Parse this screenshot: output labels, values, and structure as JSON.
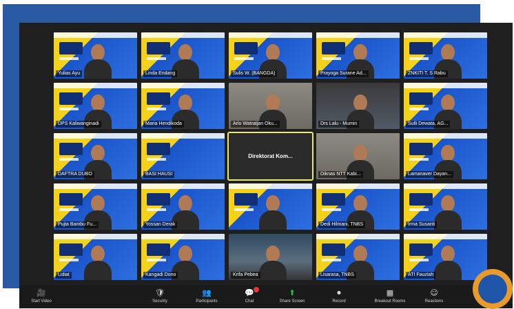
{
  "participants": [
    {
      "name": "Yulias Ayu",
      "style": "banner"
    },
    {
      "name": "Linda Endang",
      "style": "banner"
    },
    {
      "name": "Sulis W. (BANGDA)",
      "style": "banner"
    },
    {
      "name": "Prayoga Surane Ad...",
      "style": "banner"
    },
    {
      "name": "ZNKITI T. S Rabu",
      "style": "banner"
    },
    {
      "name": "DPS Kaliwanginadi",
      "style": "banner"
    },
    {
      "name": "Maria Hendikoda",
      "style": "banner"
    },
    {
      "name": "Arlo Watratjan Oku...",
      "style": "room"
    },
    {
      "name": "Drs Lalu - Mumin",
      "style": "room2"
    },
    {
      "name": "Sulli Dewata, AG...",
      "style": "banner"
    },
    {
      "name": "DAFTRA DUBO",
      "style": "banner"
    },
    {
      "name": "BASI HAUSI",
      "style": "banner"
    },
    {
      "name": "",
      "style": "dark",
      "center": "Direktorat Kom..."
    },
    {
      "name": "Diknas NTT Kabi...",
      "style": "room"
    },
    {
      "name": "Lamanaver Dayan...",
      "style": "banner"
    },
    {
      "name": "Pujta Bambu Fu...",
      "style": "banner"
    },
    {
      "name": "Yossan Derak",
      "style": "banner"
    },
    {
      "name": "",
      "style": "banner"
    },
    {
      "name": "Dedi Hilmani, TNBS",
      "style": "banner"
    },
    {
      "name": "Irma Susanti",
      "style": "banner"
    },
    {
      "name": "Lidiat",
      "style": "banner"
    },
    {
      "name": "Kangadi Dono",
      "style": "banner"
    },
    {
      "name": "Krifa Pebea",
      "style": "outdoor"
    },
    {
      "name": "Lisarasa, TNBS",
      "style": "banner"
    },
    {
      "name": "ATI Fauziah",
      "style": "banner"
    }
  ],
  "toolbar": [
    {
      "icon": "🎥",
      "label": "Start Video",
      "icon_name": "video-icon"
    },
    {
      "icon": "🛡",
      "label": "Security",
      "icon_name": "shield-icon"
    },
    {
      "icon": "👥",
      "label": "Participants",
      "icon_name": "participants-icon"
    },
    {
      "icon": "💬",
      "label": "Chat",
      "icon_name": "chat-icon"
    },
    {
      "icon": "⬆",
      "label": "Share Screen",
      "icon_name": "share-screen-icon"
    },
    {
      "icon": "⏺",
      "label": "Record",
      "icon_name": "record-icon"
    },
    {
      "icon": "▦",
      "label": "Breakout Rooms",
      "icon_name": "breakout-icon"
    },
    {
      "icon": "☺",
      "label": "Reactions",
      "icon_name": "reactions-icon"
    }
  ],
  "colors": {
    "frame": "#2a5aa3",
    "banner_yellow": "#f4d21c",
    "banner_blue": "#1a55c9",
    "accent_orange": "#e89b2a"
  }
}
